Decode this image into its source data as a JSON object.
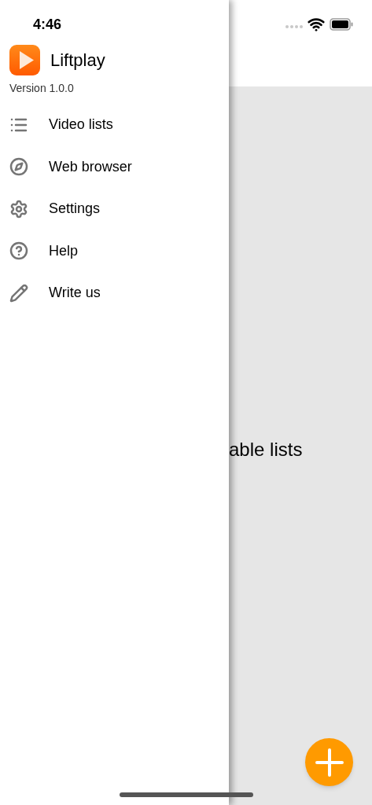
{
  "status_bar": {
    "time": "4:46"
  },
  "drawer": {
    "app_name": "Liftplay",
    "version": "Version 1.0.0",
    "items": [
      {
        "kind": "list",
        "label": "Video lists"
      },
      {
        "kind": "compass",
        "label": "Web browser"
      },
      {
        "kind": "gear",
        "label": "Settings"
      },
      {
        "kind": "help",
        "label": "Help"
      },
      {
        "kind": "pencil",
        "label": "Write us"
      }
    ]
  },
  "main": {
    "empty_message": "able lists"
  }
}
